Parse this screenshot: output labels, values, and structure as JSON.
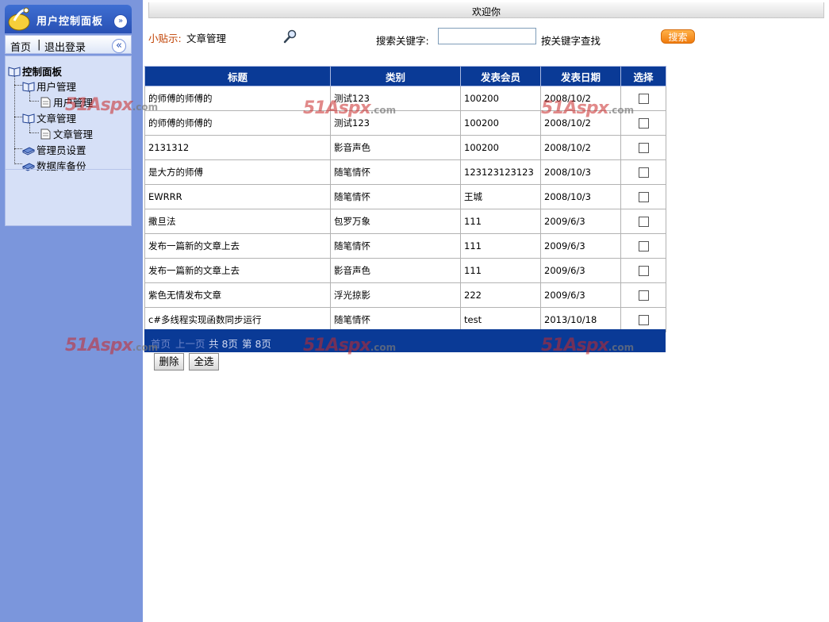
{
  "sidebar": {
    "panel_title": "用户控制面板",
    "links": {
      "home": "首页",
      "separator": "|",
      "logout": "退出登录"
    },
    "tree": {
      "root": "控制面板",
      "user_mgmt": "用户管理",
      "user_mgmt_child": "用户管理",
      "article_mgmt": "文章管理",
      "article_mgmt_child": "文章管理",
      "admin_settings": "管理员设置",
      "db_backup": "数据库备份"
    }
  },
  "header": {
    "welcome": "欢迎你"
  },
  "tip": {
    "label": "小贴示:",
    "value": "文章管理"
  },
  "search": {
    "label": "搜索关键字:",
    "value": "",
    "hint": "按关键字查找",
    "button": "搜索"
  },
  "table": {
    "columns": [
      "标题",
      "类别",
      "发表会员",
      "发表日期",
      "选择"
    ],
    "rows": [
      [
        "的师傅的师傅的",
        "测试123",
        "100200",
        "2008/10/2"
      ],
      [
        "的师傅的师傅的",
        "测试123",
        "100200",
        "2008/10/2"
      ],
      [
        "2131312",
        "影音声色",
        "100200",
        "2008/10/2"
      ],
      [
        "是大方的师傅",
        "随笔情怀",
        "123123123123",
        "2008/10/3"
      ],
      [
        "EWRRR",
        "随笔情怀",
        "王城",
        "2008/10/3"
      ],
      [
        "撒旦法",
        "包罗万象",
        "111",
        "2009/6/3"
      ],
      [
        "发布一篇新的文章上去",
        "随笔情怀",
        "111",
        "2009/6/3"
      ],
      [
        "发布一篇新的文章上去",
        "影音声色",
        "111",
        "2009/6/3"
      ],
      [
        "紫色无情发布文章",
        "浮光掠影",
        "222",
        "2009/6/3"
      ],
      [
        "c#多线程实现函数同步运行",
        "随笔情怀",
        "test",
        "2013/10/18"
      ]
    ]
  },
  "pager": {
    "first": "首页",
    "prev": "上一页",
    "total": "共 8页",
    "current": "第 8页"
  },
  "actions": {
    "delete": "删除",
    "select_all": "全选"
  },
  "watermark": {
    "brand": "51Aspx",
    "suffix": ".com"
  },
  "colors": {
    "sidebar_bg": "#7b96dc",
    "table_header": "#0a3a96",
    "search_button": "#f07b0c",
    "tip_label": "#c04000"
  },
  "icons": {
    "logo": "hand-logo-icon",
    "collapse": "double-chevron-down-icon",
    "back": "double-chevron-left-icon",
    "search": "magnifier-icon",
    "folder": "open-book-icon",
    "page": "page-icon",
    "setting": "book-stack-icon"
  }
}
